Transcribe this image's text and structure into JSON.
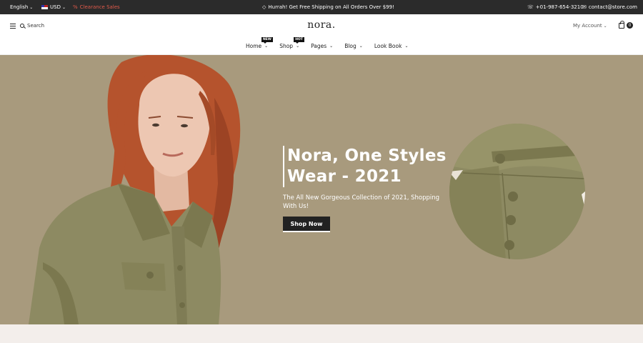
{
  "topbar": {
    "language": "English",
    "currency": "USD",
    "clearance": "Clearance Sales",
    "promo": "Hurrah! Get Free Shipping on All Orders Over $99!",
    "phone": "+01-987-654-3210",
    "email": "contact@store.com"
  },
  "header": {
    "search_label": "Search",
    "logo": "nora.",
    "account_label": "My Account",
    "cart_count": "0"
  },
  "nav": {
    "items": [
      {
        "label": "Home",
        "tag": "NEW"
      },
      {
        "label": "Shop",
        "tag": "HOT"
      },
      {
        "label": "Pages"
      },
      {
        "label": "Blog"
      },
      {
        "label": "Look Book"
      }
    ]
  },
  "hero": {
    "title_line1": "Nora, One Styles",
    "title_line2": "Wear - 2021",
    "subtitle": "The All New Gorgeous Collection of 2021, Shopping With Us!",
    "button_label": "Shop Now"
  },
  "colors": {
    "hero_bg": "#a89a7d",
    "jacket": "#8d8a62",
    "hair": "#b5532d",
    "topbar_bg": "#2b2b2b",
    "clearance": "#e05a4a"
  },
  "icons": {
    "menu": "menu-icon",
    "search": "search-icon",
    "cart": "cart-icon",
    "phone": "phone-icon",
    "email": "email-icon",
    "clearance": "percent-icon",
    "promo": "gift-icon"
  }
}
